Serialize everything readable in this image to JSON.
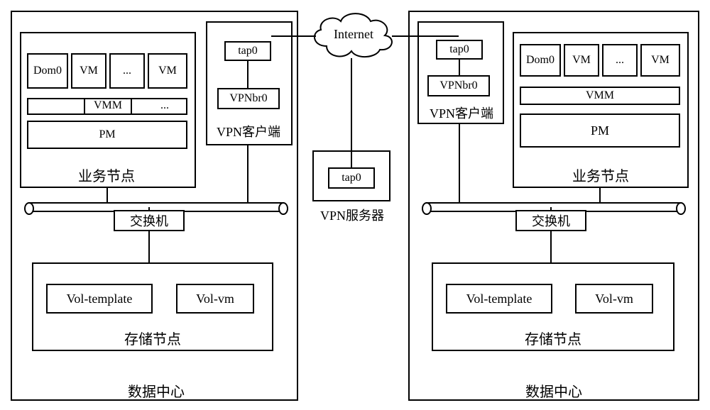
{
  "internet": "Internet",
  "vpn_server": {
    "tap": "tap0",
    "label": "VPN服务器"
  },
  "left": {
    "dc_label": "数据中心",
    "biz": {
      "label": "业务节点",
      "cells": {
        "dom0": "Dom0",
        "vm1": "VM",
        "dots": "...",
        "vm2": "VM"
      },
      "vmm": "VMM",
      "dots2": "...",
      "pm": "PM"
    },
    "vpn": {
      "tap": "tap0",
      "br": "VPNbr0",
      "label": "VPN客户端"
    },
    "switch": "交换机",
    "storage": {
      "tpl": "Vol-template",
      "vm": "Vol-vm",
      "label": "存储节点"
    }
  },
  "right": {
    "dc_label": "数据中心",
    "biz": {
      "label": "业务节点",
      "cells": {
        "dom0": "Dom0",
        "vm1": "VM",
        "dots": "...",
        "vm2": "VM"
      },
      "vmm": "VMM",
      "pm": "PM"
    },
    "vpn": {
      "tap": "tap0",
      "br": "VPNbr0",
      "label": "VPN客户端"
    },
    "switch": "交换机",
    "storage": {
      "tpl": "Vol-template",
      "vm": "Vol-vm",
      "label": "存储节点"
    }
  }
}
